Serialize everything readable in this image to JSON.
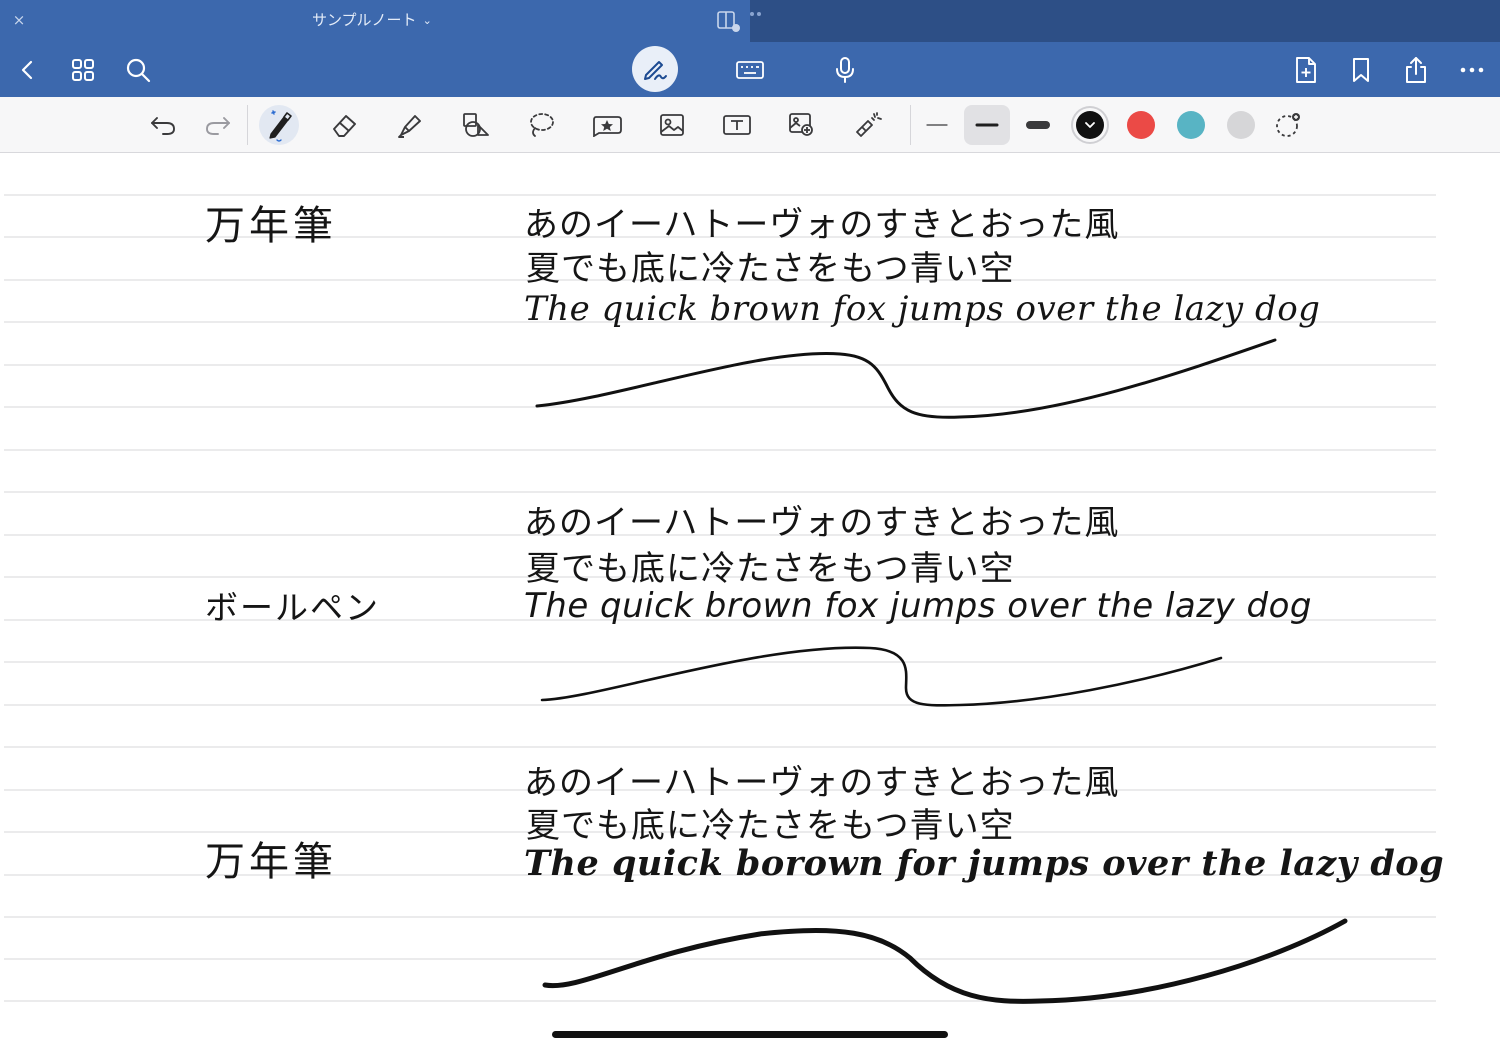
{
  "titlebar": {
    "close_glyph": "×",
    "title": "サンプルノート",
    "title_chevron": "⌄"
  },
  "toolbar": {
    "left": [
      "back-icon",
      "grid-icon",
      "search-icon"
    ],
    "center": [
      "pen-mode-icon",
      "keyboard-icon",
      "microphone-icon"
    ],
    "right": [
      "add-page-icon",
      "bookmark-icon",
      "share-icon",
      "more-icon"
    ],
    "active_mode": "pen"
  },
  "pen_tools": {
    "tools": [
      "undo-icon",
      "redo-icon",
      "pen-icon",
      "eraser-icon",
      "highlighter-icon",
      "shapes-icon",
      "lasso-icon",
      "elements-icon",
      "image-icon",
      "text-box-icon",
      "camera-scan-icon",
      "laser-pointer-icon"
    ],
    "active_tool": "pen",
    "thickness_options": [
      "thin",
      "medium",
      "thick"
    ],
    "selected_thickness": "medium",
    "colors": [
      "#111111",
      "#eb4a46",
      "#58b4c4",
      "#d6d6d8"
    ],
    "selected_color": "#111111"
  },
  "page": {
    "sections": [
      {
        "label": "万年筆",
        "lines": [
          "あのイーハトーヴォのすきとおった風",
          "夏でも底に冷たさをもつ青い空",
          "The quick brown fox jumps over the lazy dog"
        ]
      },
      {
        "label": "ボールペン",
        "lines": [
          "あのイーハトーヴォのすきとおった風",
          "夏でも底に冷たさをもつ青い空",
          "The quick brown fox jumps over the lazy dog"
        ]
      },
      {
        "label": "万年筆",
        "lines": [
          "あのイーハトーヴォのすきとおった風",
          "夏でも底に冷たさをもつ青い空",
          "The quick borown for jumps over the lazy dog"
        ]
      }
    ]
  }
}
